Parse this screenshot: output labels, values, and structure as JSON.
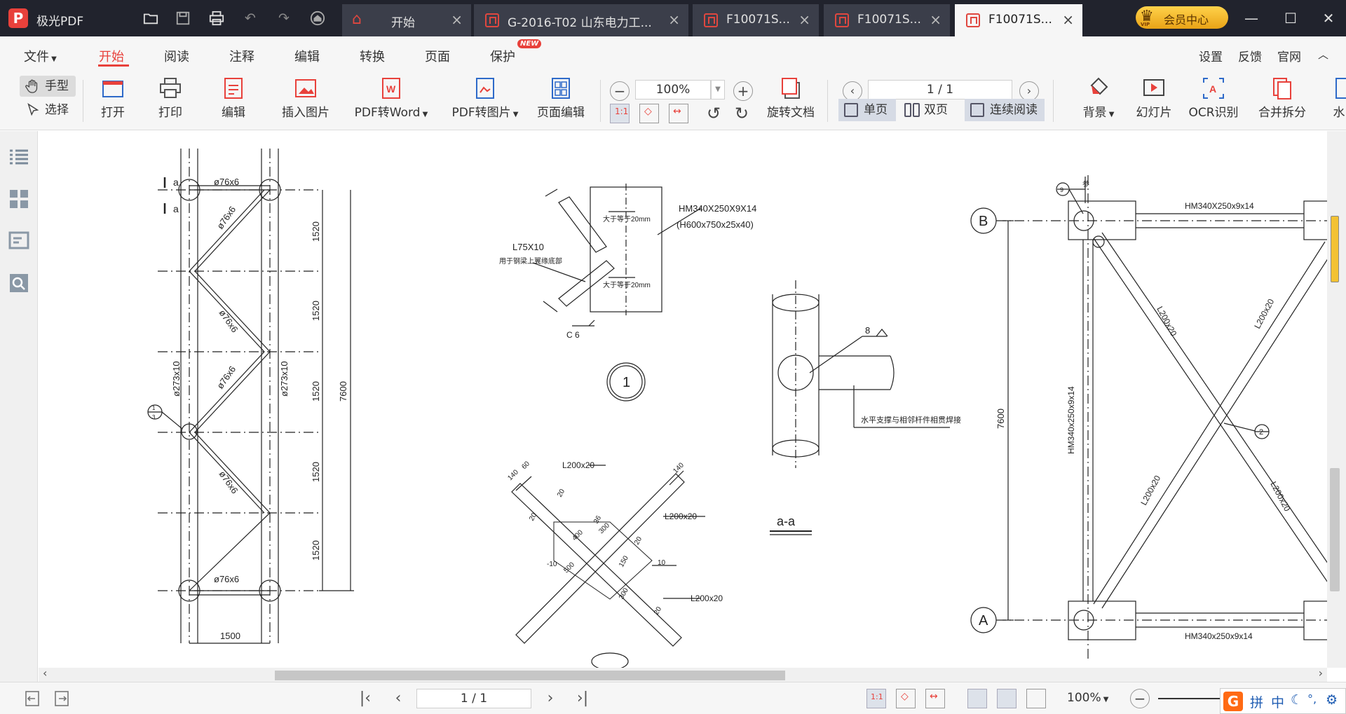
{
  "app": {
    "name": "极光PDF",
    "logo_letter": "P"
  },
  "tabs": [
    {
      "label": "开始",
      "icon": "home-icon",
      "active": false
    },
    {
      "label": "G-2016-T02 山东电力工...",
      "icon": "pdf-icon",
      "active": false
    },
    {
      "label": "F10071S...",
      "icon": "pdf-icon",
      "active": false
    },
    {
      "label": "F10071S...",
      "icon": "pdf-icon",
      "active": false
    },
    {
      "label": "F10071S...",
      "icon": "pdf-icon",
      "active": true
    }
  ],
  "vip": {
    "label": "会员中心",
    "badge": "VIP"
  },
  "menu": {
    "file": "文件",
    "start": "开始",
    "read": "阅读",
    "annotate": "注释",
    "edit": "编辑",
    "convert": "转换",
    "page": "页面",
    "protect": "保护",
    "new_badge": "NEW",
    "settings": "设置",
    "feedback": "反馈",
    "website": "官网"
  },
  "toolbar": {
    "hand": "手型",
    "select": "选择",
    "open": "打开",
    "print": "打印",
    "edit": "编辑",
    "insert_image": "插入图片",
    "pdf_to_word": "PDF转Word",
    "pdf_to_image": "PDF转图片",
    "page_edit": "页面编辑",
    "zoom": "100%",
    "rotate_doc": "旋转文档",
    "page_input": "1 / 1",
    "single_page": "单页",
    "double_page": "双页",
    "continuous": "连续阅读",
    "background": "背景",
    "slideshow": "幻灯片",
    "ocr": "OCR识别",
    "merge_split": "合并拆分",
    "watermark_cut": "水"
  },
  "statusbar": {
    "page_input": "1 / 1",
    "zoom": "100%"
  },
  "ime": {
    "logo": "G",
    "mode": "拼",
    "lang": "中"
  },
  "drawing": {
    "left_truss": {
      "pipe_labels": [
        "ø76x6",
        "ø76x6",
        "ø76x6",
        "ø76x6",
        "ø76x6",
        "ø76x6"
      ],
      "chord_left": "ø273x10",
      "chord_right": "ø273x10",
      "spans": [
        "1520",
        "1520",
        "1520",
        "1520",
        "1520"
      ],
      "total_height": "7600",
      "width": "1500",
      "section_mark": "a",
      "node_mark_top": "1",
      "node_mark_bottom": "3"
    },
    "detail_1": {
      "beam": "HM340X250X9X14",
      "beam_alt": "(H600x750x25x40)",
      "angle": "L75X10",
      "angle_note": "用于钢梁上翼缘底部",
      "weld_note_1": "大于等于20mm",
      "weld_note_2": "大于等于20mm",
      "channel": "C 6",
      "circle_label": "1"
    },
    "section_aa": {
      "weld": "8",
      "note": "水平支撑与相邻杆件相贯焊接",
      "title": "a-a"
    },
    "detail_2": {
      "labels": [
        "L200x20",
        "L200x20",
        "L200x20"
      ],
      "dims": [
        "140",
        "60",
        "140",
        "20",
        "20",
        "20",
        "20",
        "400",
        "300",
        "-10",
        "500",
        "10",
        "150",
        "36",
        "300"
      ]
    },
    "right_frame": {
      "axis_top": "B",
      "axis_bottom": "A",
      "beam_top": "HM340X250x9x14",
      "beam_bottom": "HM340x250x9x14",
      "column": "HM340x250x9x14",
      "height": "7600",
      "braces": [
        "L200x20",
        "L200x20",
        "L200x20",
        "L200x20"
      ],
      "detail_mark": "2",
      "note_mark": "9",
      "ref": "参"
    }
  }
}
